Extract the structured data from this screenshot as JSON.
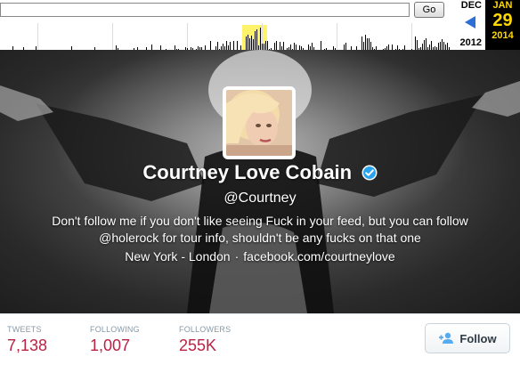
{
  "wayback": {
    "url_value": "",
    "go_label": "Go",
    "prev_month": "DEC",
    "prev_year": "2012",
    "cur_month": "JAN",
    "cur_day": "29",
    "cur_year": "2014",
    "colors": {
      "accent": "#ffd800",
      "arrow": "#2d6fd6",
      "highlight": "#fff36b"
    }
  },
  "profile": {
    "name": "Courtney Love Cobain",
    "handle": "@Courtney",
    "bio": "Don't follow me if you don't like seeing Fuck in your feed, but you can follow @holerock for tour info, shouldn't be any fucks on that one",
    "location": "New York - London",
    "separator": "·",
    "website": "facebook.com/courtneylove",
    "verified_icon": "verified-badge-icon"
  },
  "stats": {
    "tweets_label": "TWEETS",
    "tweets_value": "7,138",
    "following_label": "FOLLOWING",
    "following_value": "1,007",
    "followers_label": "FOLLOWERS",
    "followers_value": "255K",
    "value_color": "#ba2244"
  },
  "follow": {
    "label": "Follow",
    "icon": "add-user-icon"
  }
}
